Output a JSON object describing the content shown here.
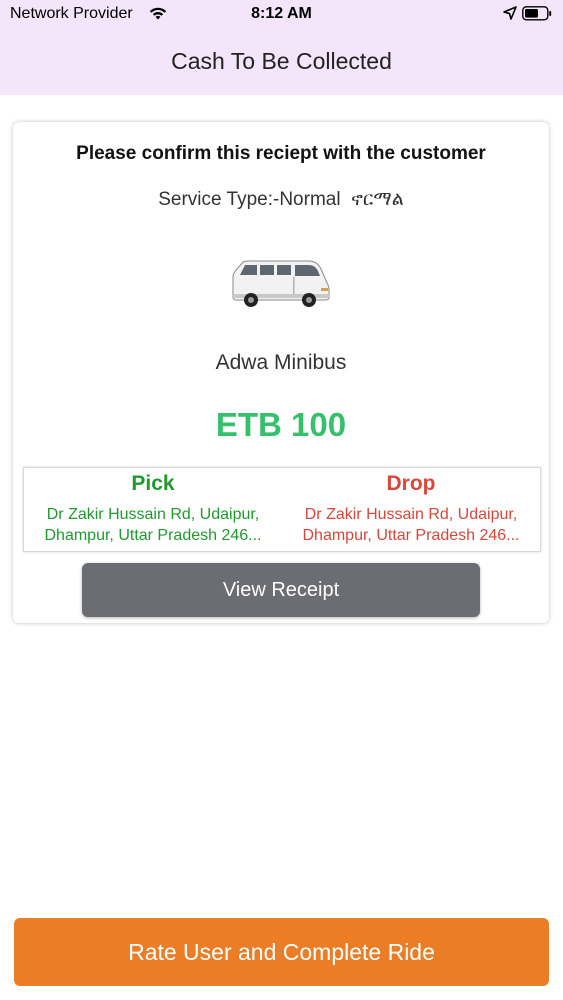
{
  "status_bar": {
    "carrier": "Network Provider",
    "time": "8:12 AM",
    "icons": [
      "wifi-icon",
      "location-arrow-icon",
      "battery-icon"
    ]
  },
  "header": {
    "title": "Cash To Be Collected"
  },
  "receipt": {
    "heading": "Please confirm this reciept with the customer",
    "service_type": "Service Type:-Normal  ኖርማል",
    "vehicle_image": "minibus-image",
    "vehicle_name": "Adwa Minibus",
    "fare": "ETB 100",
    "pick": {
      "label": "Pick",
      "address": "Dr Zakir Hussain Rd, Udaipur, Dhampur, Uttar Pradesh 246..."
    },
    "drop": {
      "label": "Drop",
      "address": "Dr Zakir Hussain Rd, Udaipur, Dhampur, Uttar Pradesh 246..."
    },
    "view_receipt_label": "View Receipt"
  },
  "footer": {
    "complete_label": "Rate User and Complete Ride"
  },
  "colors": {
    "header_bg": "#f3e6fb",
    "fare": "#35c06c",
    "pick": "#1e9a2e",
    "drop": "#d9463a",
    "view_receipt_bg": "#6c6c73",
    "complete_bg": "#ea7d25"
  }
}
